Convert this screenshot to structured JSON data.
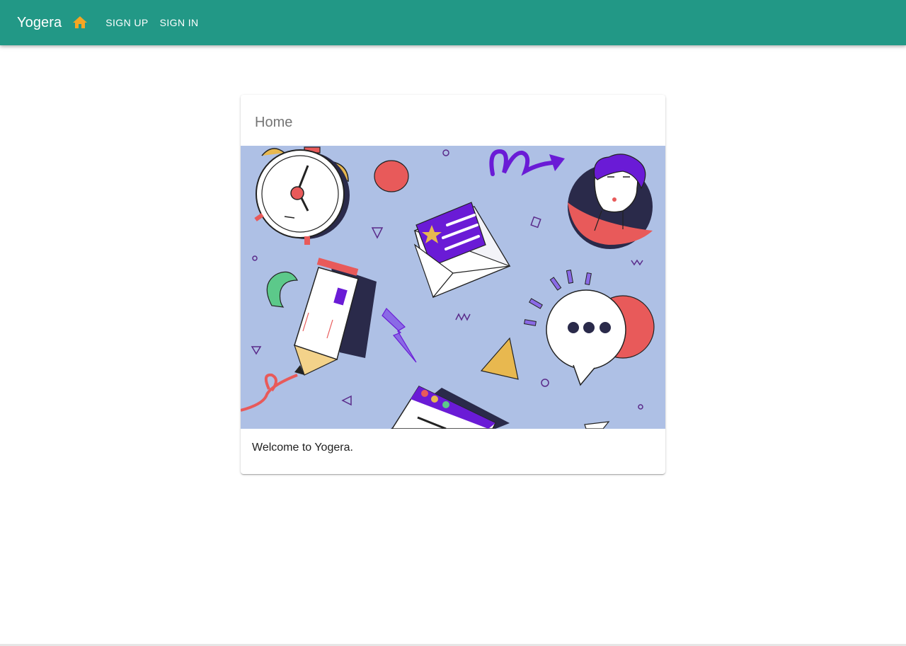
{
  "appbar": {
    "title": "Yogera",
    "home_icon": "home-icon",
    "nav": [
      {
        "label": "SIGN UP"
      },
      {
        "label": "SIGN IN"
      }
    ]
  },
  "card": {
    "title": "Home",
    "media_icon": "illustration-image",
    "text": "Welcome to Yogera."
  },
  "colors": {
    "appbar": "#229886",
    "home_icon": "#f5a623",
    "media_background": "#aec0e5"
  }
}
